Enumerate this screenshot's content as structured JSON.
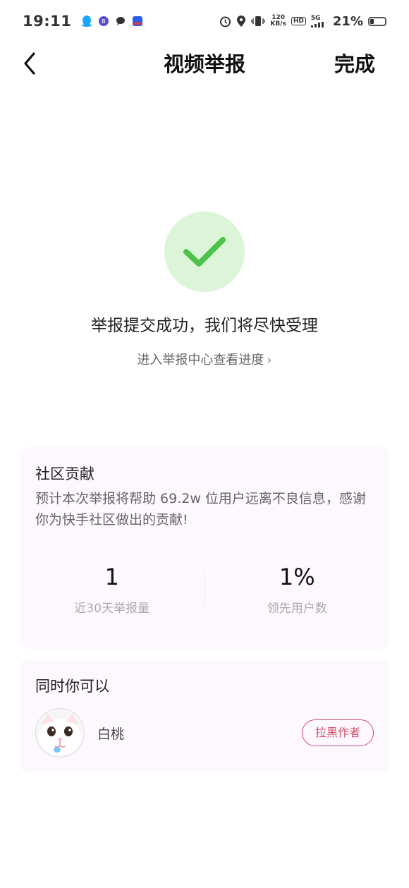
{
  "status_bar": {
    "time": "19:11",
    "network_speed_value": "120",
    "network_speed_unit": "KB/s",
    "hd_badge": "HD",
    "signal_label": "5G",
    "battery_percent": "21%"
  },
  "nav": {
    "title": "视频举报",
    "done_label": "完成"
  },
  "success": {
    "message": "举报提交成功，我们将尽快受理",
    "progress_link": "进入举报中心查看进度"
  },
  "community": {
    "title": "社区贡献",
    "description": "预计本次举报将帮助 69.2w 位用户远离不良信息，感谢你为快手社区做出的贡献!",
    "stats": [
      {
        "value": "1",
        "label": "近30天举报量"
      },
      {
        "value": "1%",
        "label": "领先用户数"
      }
    ]
  },
  "actions": {
    "title": "同时你可以",
    "user_name": "白桃",
    "block_label": "拉黑作者"
  },
  "colors": {
    "success_bg": "#dcf5d8",
    "success_check": "#4cc24a",
    "card_bg": "#fdf8fd",
    "accent": "#d0506c"
  }
}
